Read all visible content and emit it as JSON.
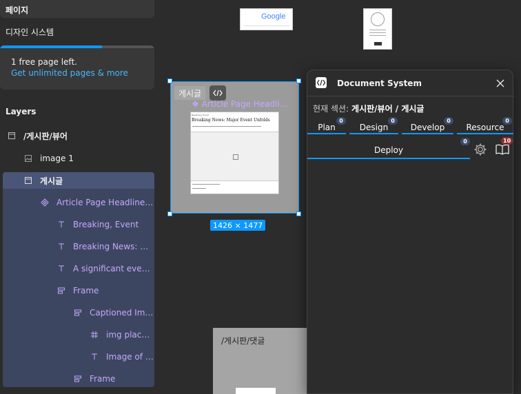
{
  "sidebar": {
    "pages_header": "페이지",
    "current_page": "디자인 시스템",
    "upgrade": {
      "progress": 0.66,
      "text": "1 free page left.",
      "link": "Get unlimited pages & more"
    },
    "layers_title": "Layers",
    "layers": [
      {
        "label": "/게시판/뷰어",
        "icon": "frame-icon",
        "depth": 0
      },
      {
        "label": "image 1",
        "icon": "image-icon",
        "depth": 1
      },
      {
        "label": "게시글",
        "icon": "frame-icon",
        "depth": 1
      },
      {
        "label": "Article Page Headline wit...",
        "icon": "component-instance-icon",
        "depth": 2
      },
      {
        "label": "Breaking, Event",
        "icon": "text-icon",
        "depth": 3
      },
      {
        "label": "Breaking News: Majo...",
        "icon": "text-icon",
        "depth": 3
      },
      {
        "label": "A significant event h...",
        "icon": "text-icon",
        "depth": 3
      },
      {
        "label": "Frame",
        "icon": "auto-layout-icon",
        "depth": 3
      },
      {
        "label": "Captioned Image",
        "icon": "auto-layout-icon",
        "depth": 4
      },
      {
        "label": "img placeh...",
        "icon": "hash-frame-icon",
        "depth": 5
      },
      {
        "label": "Image of th...",
        "icon": "text-icon",
        "depth": 5
      },
      {
        "label": "Frame",
        "icon": "auto-layout-icon",
        "depth": 4
      }
    ]
  },
  "canvas": {
    "google_thumb_text": "Google",
    "selected_frame_label": "게시글",
    "component_label": "Article Page Headli...",
    "mini_headline": "Breaking News: Major Event Unfolds",
    "mini_small": "Breaking | Event",
    "size_badge": "1426 × 1477",
    "comment_frame_label": "/게시판/댓글"
  },
  "panel": {
    "title": "Document System",
    "section_label": "현재 섹션:",
    "section_value": "게시판/뷰어 / 게시글",
    "tabs": [
      {
        "label": "Plan",
        "count": "0"
      },
      {
        "label": "Design",
        "count": "0"
      },
      {
        "label": "Develop",
        "count": "0"
      },
      {
        "label": "Resource",
        "count": "0"
      }
    ],
    "deploy": {
      "label": "Deploy",
      "count": "0"
    },
    "settings_count": "",
    "docs_count": "10",
    "accent": "#0d99ff"
  }
}
